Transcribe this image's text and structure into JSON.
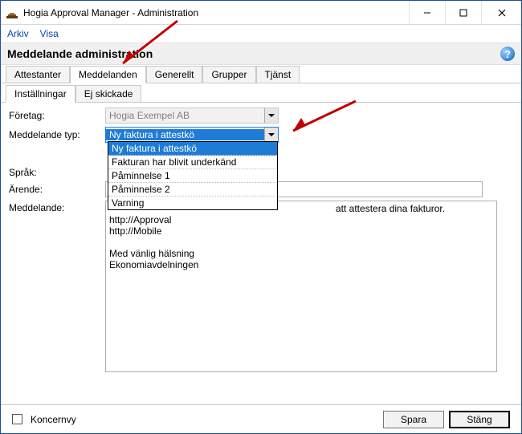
{
  "window": {
    "title": "Hogia Approval Manager - Administration"
  },
  "menubar": {
    "items": [
      "Arkiv",
      "Visa"
    ]
  },
  "header": {
    "title": "Meddelande administration"
  },
  "main_tabs": {
    "items": [
      "Attestanter",
      "Meddelanden",
      "Generellt",
      "Grupper",
      "Tjänst"
    ],
    "active_index": 1
  },
  "sub_tabs": {
    "items": [
      "Inställningar",
      "Ej skickade"
    ],
    "active_index": 0
  },
  "form": {
    "company_label": "Företag:",
    "company_value": "Hogia Exempel AB",
    "type_label": "Meddelande typ:",
    "type_value": "Ny faktura i attestkö",
    "type_options": [
      "Ny faktura i attestkö",
      "Fakturan har blivit underkänd",
      "Påminnelse 1",
      "Påminnelse 2",
      "Varning"
    ],
    "language_label": "Språk:",
    "subject_label": "Ärende:",
    "message_label": "Meddelande:",
    "message_tail": "att attestera dina fakturor.",
    "message_body": "http://Approval\nhttp://Mobile\n\nMed vänlig hälsning\nEkonomiavdelningen"
  },
  "footer": {
    "koncern_label": "Koncernvy",
    "save_label": "Spara",
    "close_label": "Stäng"
  }
}
